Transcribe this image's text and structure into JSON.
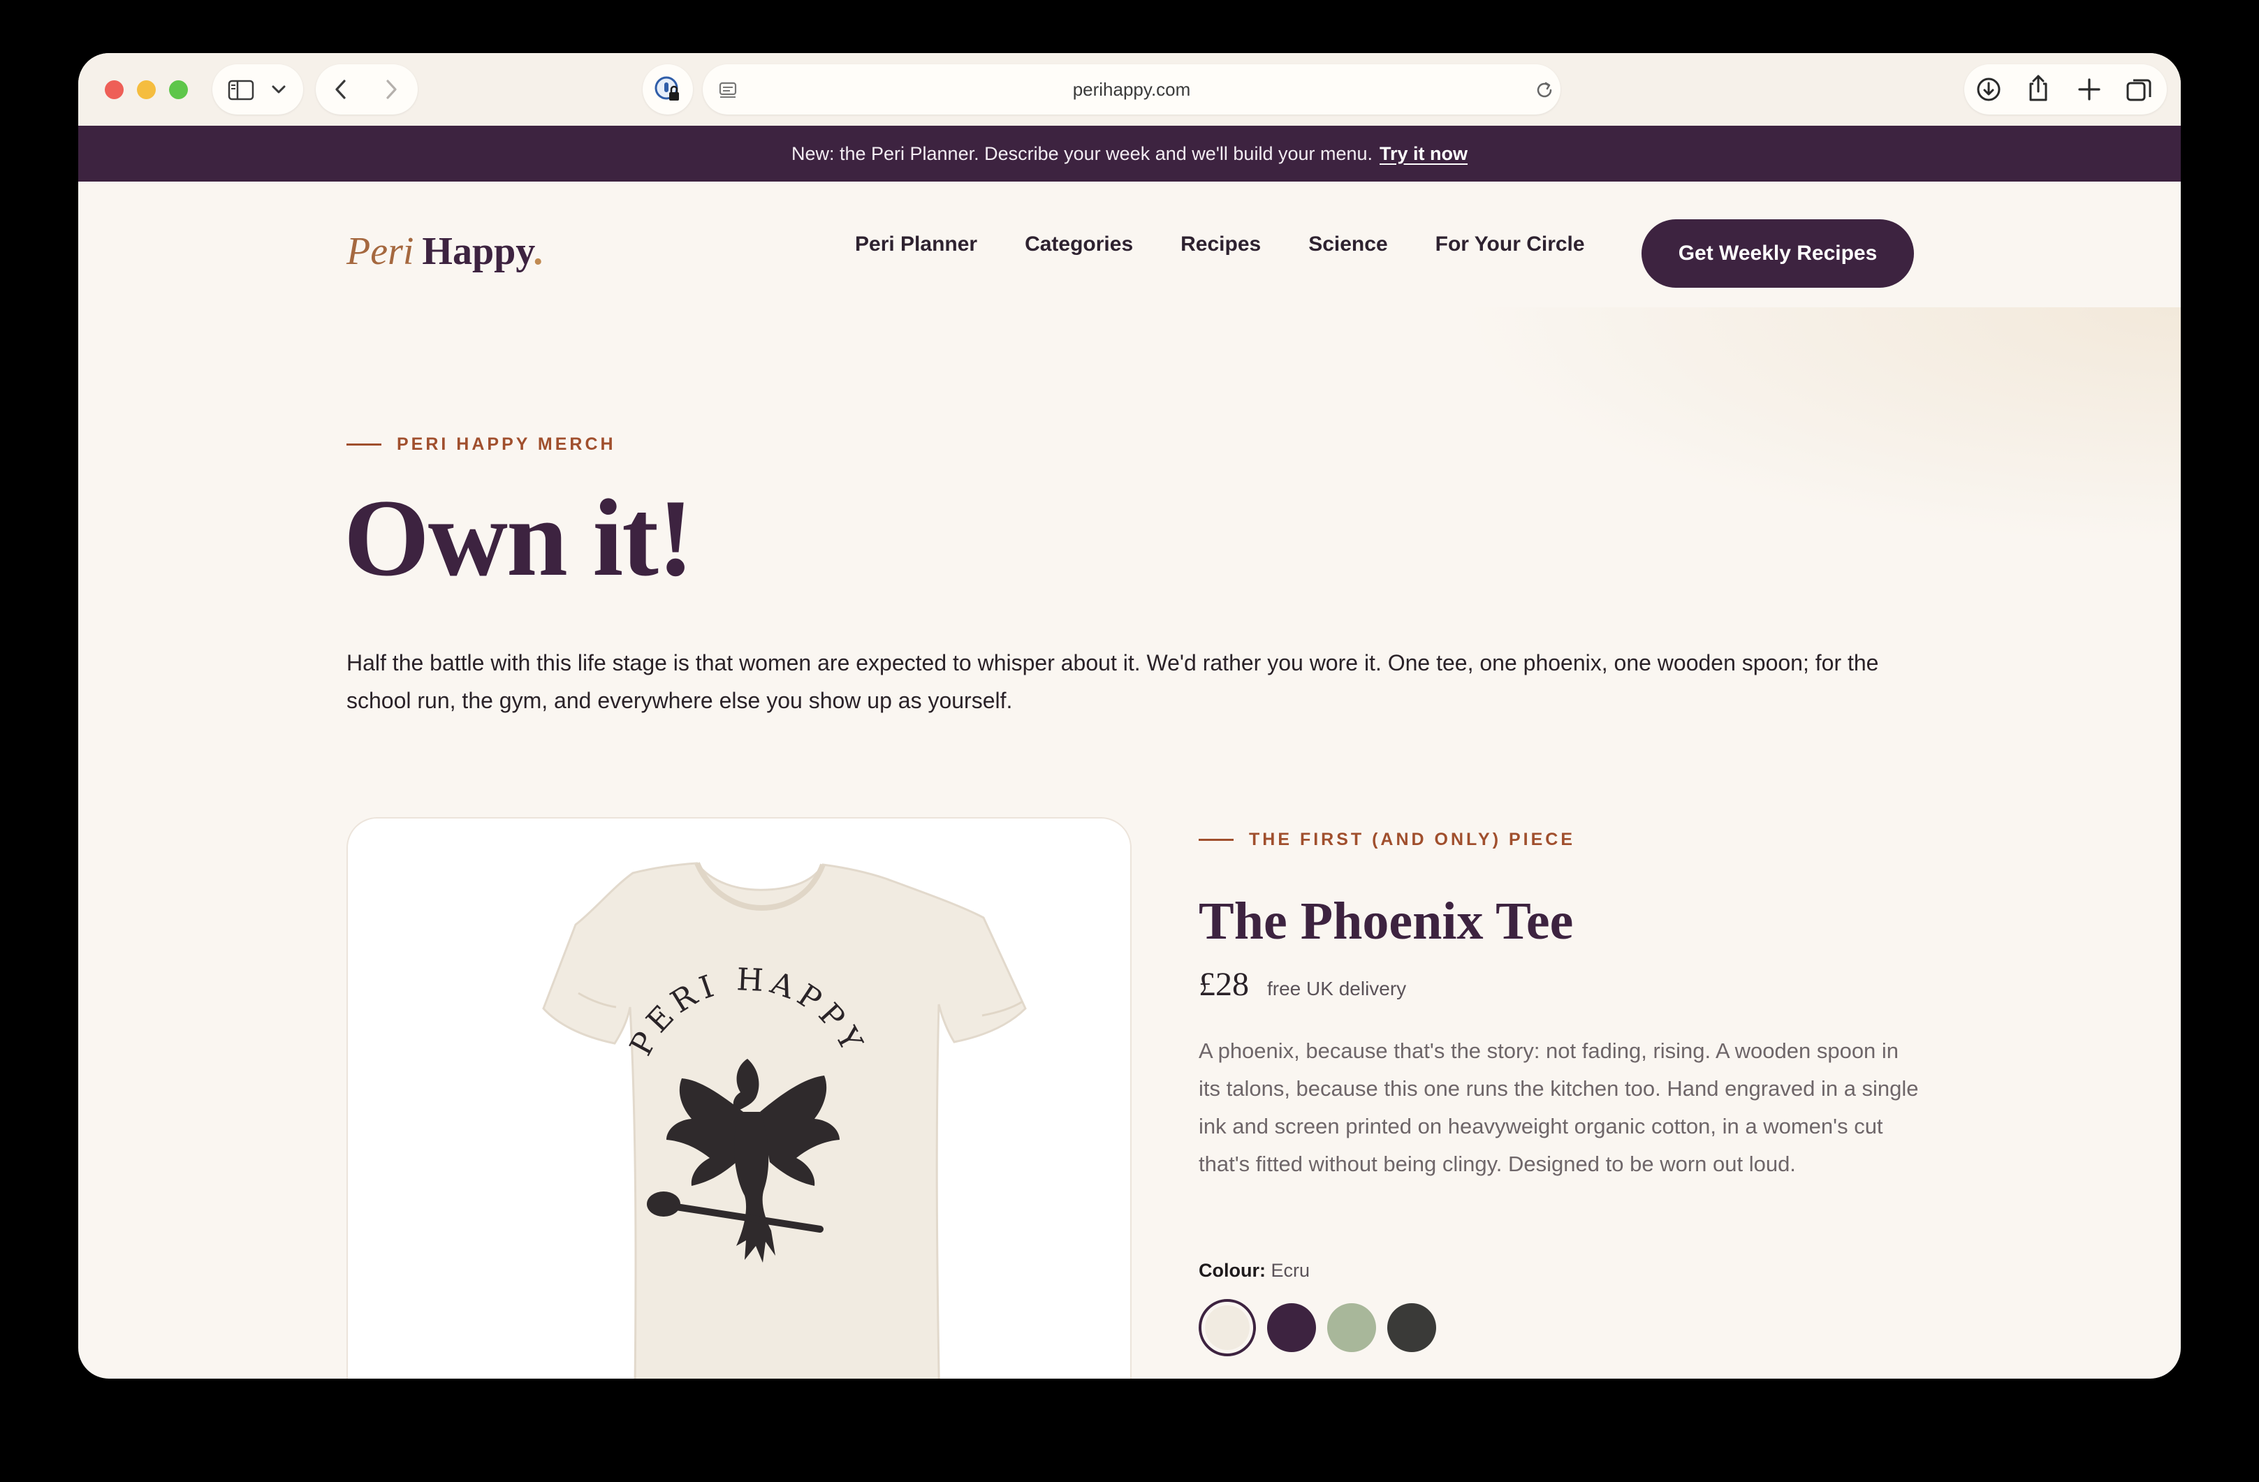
{
  "browser": {
    "url": "perihappy.com",
    "icons": [
      "sidebar-icon",
      "chevron-down-icon",
      "back-icon",
      "forward-icon",
      "password-lock-icon",
      "page-menu-icon",
      "reload-icon",
      "download-icon",
      "share-icon",
      "new-tab-icon",
      "tabs-overview-icon"
    ]
  },
  "announcement": {
    "text": "New: the Peri Planner. Describe your week and we'll build your menu.",
    "link": "Try it now"
  },
  "header": {
    "logo_peri": "Peri",
    "logo_happy": "Happy",
    "logo_dot": ".",
    "nav": [
      "Peri Planner",
      "Categories",
      "Recipes",
      "Science",
      "For Your Circle"
    ],
    "cta": "Get Weekly Recipes"
  },
  "hero": {
    "eyebrow": "PERI HAPPY MERCH",
    "title": "Own it!",
    "lead": "Half the battle with this life stage is that women are expected to whisper about it. We'd rather you wore it. One tee, one phoenix, one wooden spoon; for the school run, the gym, and everywhere else you show up as yourself."
  },
  "product": {
    "image_print_text": "PERI HAPPY",
    "eyebrow": "THE FIRST (AND ONLY) PIECE",
    "title": "The Phoenix Tee",
    "price": "£28",
    "price_note": "free UK delivery",
    "description": "A phoenix, because that's the story: not fading, rising. A wooden spoon in its talons, because this one runs the kitchen too. Hand engraved in a single ink and screen printed on heavyweight organic cotton, in a women's cut that's fitted without being clingy. Designed to be worn out loud.",
    "colour_label": "Colour:",
    "colour_selected": "Ecru",
    "swatches": [
      {
        "name": "ecru",
        "color": "#f1ebe1",
        "selected": true
      },
      {
        "name": "plum",
        "color": "#3d2340",
        "selected": false
      },
      {
        "name": "sage",
        "color": "#a8b79a",
        "selected": false
      },
      {
        "name": "charcoal",
        "color": "#3a3a38",
        "selected": false
      }
    ]
  },
  "colors": {
    "brand_plum": "#3d2340",
    "accent_rust": "#a04f2d",
    "page_bg": "#faf6f1"
  }
}
